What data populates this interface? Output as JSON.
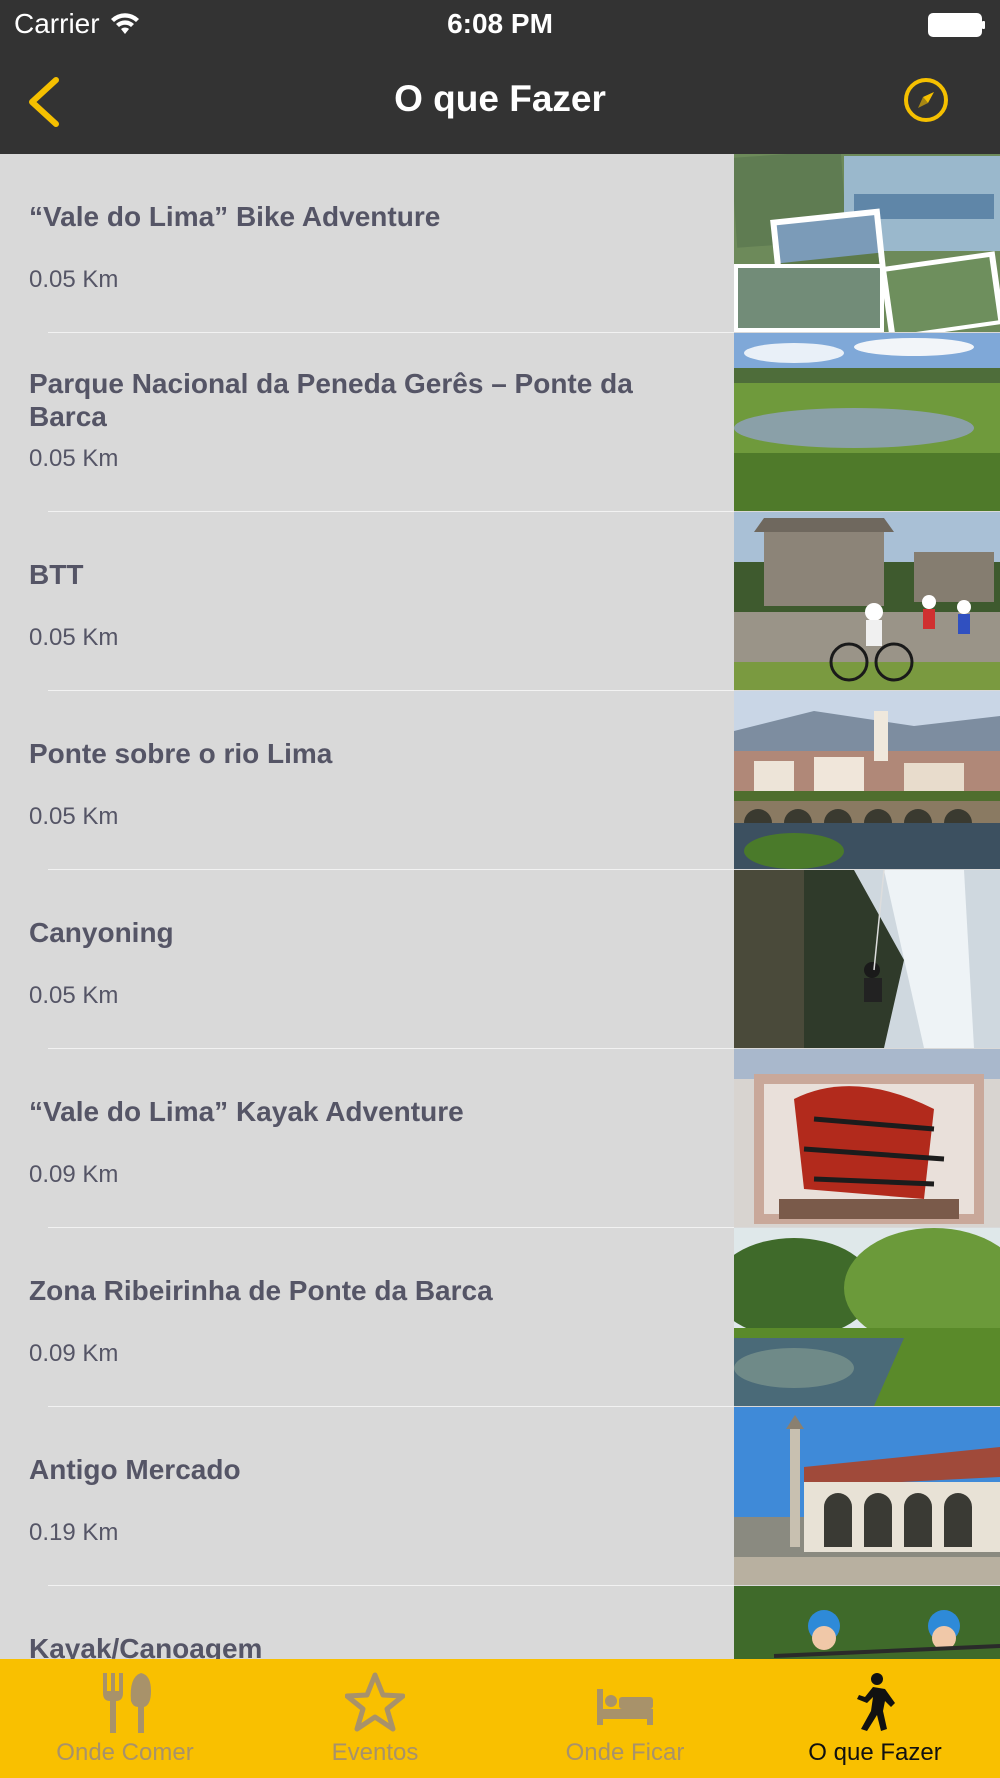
{
  "status": {
    "carrier": "Carrier",
    "time": "6:08 PM"
  },
  "nav": {
    "title": "O que Fazer",
    "back_icon": "chevron-left-icon",
    "compass_icon": "compass-icon",
    "accent": "#f5c000"
  },
  "items": [
    {
      "title": "“Vale do Lima” Bike Adventure",
      "distance": "0.05 Km"
    },
    {
      "title": "Parque Nacional da Peneda Gerês – Ponte da Barca",
      "distance": "0.05 Km"
    },
    {
      "title": "BTT",
      "distance": "0.05 Km"
    },
    {
      "title": "Ponte sobre o rio Lima",
      "distance": "0.05 Km"
    },
    {
      "title": "Canyoning",
      "distance": "0.05 Km"
    },
    {
      "title": "“Vale do Lima” Kayak Adventure",
      "distance": "0.09 Km"
    },
    {
      "title": "Zona Ribeirinha de Ponte da Barca",
      "distance": "0.09 Km"
    },
    {
      "title": "Antigo Mercado",
      "distance": "0.19 Km"
    },
    {
      "title": "Kayak/Canoagem",
      "distance": ""
    }
  ],
  "tabs": [
    {
      "label": "Onde Comer",
      "icon": "fork-knife-icon"
    },
    {
      "label": "Eventos",
      "icon": "star-icon"
    },
    {
      "label": "Onde Ficar",
      "icon": "bed-icon"
    },
    {
      "label": "O que Fazer",
      "icon": "hiker-icon",
      "active": true
    }
  ],
  "colors": {
    "nav_bg": "#333333",
    "tab_bg": "#f9c000",
    "list_bg": "#d9d9d9",
    "text": "#555566"
  }
}
